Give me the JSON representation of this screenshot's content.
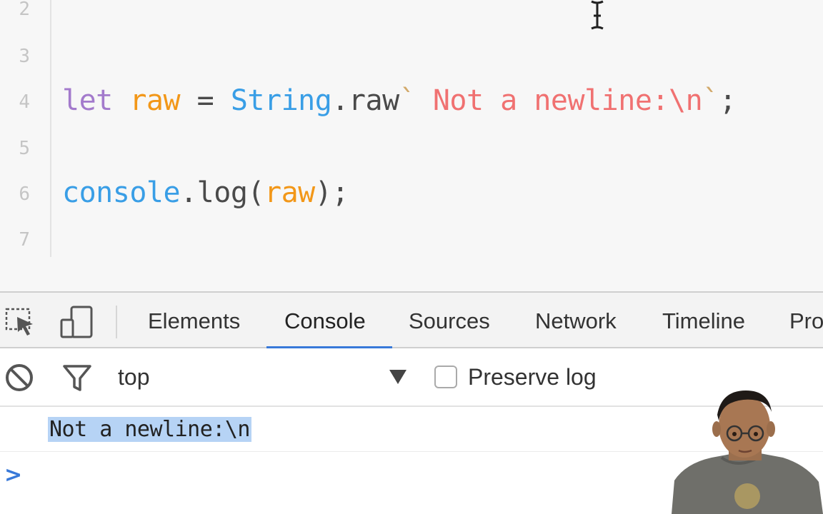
{
  "editor": {
    "lines": [
      {
        "num": "2",
        "tokens": []
      },
      {
        "num": "3",
        "tokens": []
      },
      {
        "num": "4",
        "tokens": [
          {
            "t": "let",
            "c": "kw"
          },
          {
            "t": " ",
            "c": "op"
          },
          {
            "t": "raw",
            "c": "var"
          },
          {
            "t": " = ",
            "c": "op"
          },
          {
            "t": "String",
            "c": "cls"
          },
          {
            "t": ".raw",
            "c": "fn"
          },
          {
            "t": "`",
            "c": "tick"
          },
          {
            "t": " Not a newline:\\n",
            "c": "str"
          },
          {
            "t": "`",
            "c": "tick"
          },
          {
            "t": ";",
            "c": "punc"
          }
        ]
      },
      {
        "num": "5",
        "tokens": []
      },
      {
        "num": "6",
        "tokens": [
          {
            "t": "console",
            "c": "cls"
          },
          {
            "t": ".log(",
            "c": "fn"
          },
          {
            "t": "raw",
            "c": "var"
          },
          {
            "t": ");",
            "c": "punc"
          }
        ]
      },
      {
        "num": "7",
        "tokens": []
      }
    ]
  },
  "devtools": {
    "tabs": [
      "Elements",
      "Console",
      "Sources",
      "Network",
      "Timeline",
      "Pro"
    ],
    "active_tab": "Console",
    "toolbar": {
      "inspect_icon": "inspect-element-icon",
      "device_icon": "device-mode-icon"
    },
    "filter": {
      "clear_icon": "clear-console-icon",
      "filter_icon": "filter-icon",
      "context": "top",
      "preserve_log_label": "Preserve log",
      "preserve_log_checked": false
    },
    "console": {
      "output": "Not a newline:\\n",
      "prompt": ">"
    }
  },
  "colors": {
    "active_tab_accent": "#3879d9",
    "selection": "#b6d3f5",
    "keyword": "#a37acc",
    "variable": "#f29718",
    "class": "#399ee6",
    "string": "#f07171"
  }
}
